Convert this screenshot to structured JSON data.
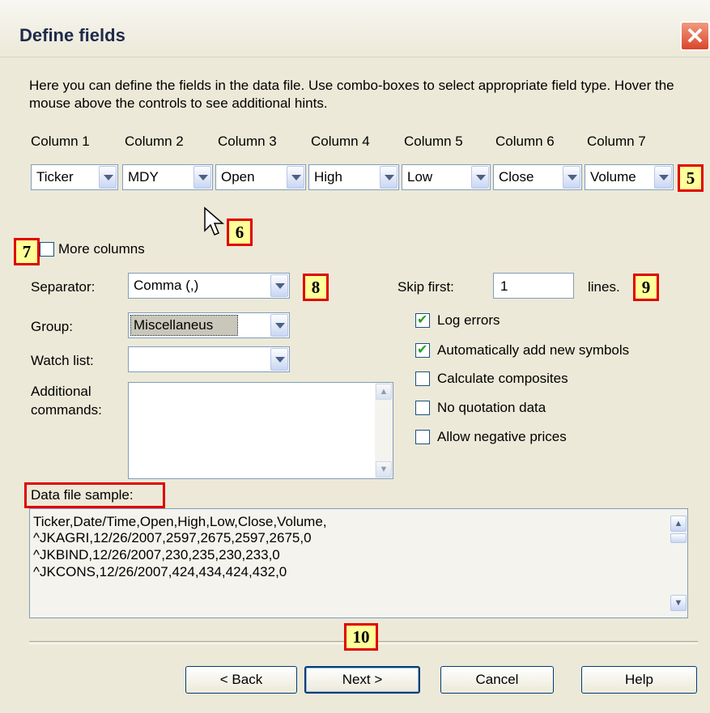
{
  "title": "Define fields",
  "intro": "Here you can define the fields in the data file. Use combo-boxes to select appropriate field type. Hover the mouse above the controls to see additional hints.",
  "columns": [
    {
      "header": "Column 1",
      "value": "Ticker"
    },
    {
      "header": "Column 2",
      "value": "MDY"
    },
    {
      "header": "Column 3",
      "value": "Open"
    },
    {
      "header": "Column 4",
      "value": "High"
    },
    {
      "header": "Column 5",
      "value": "Low"
    },
    {
      "header": "Column 6",
      "value": "Close"
    },
    {
      "header": "Column 7",
      "value": "Volume"
    }
  ],
  "callouts": {
    "c5": "5",
    "c6": "6",
    "c7": "7",
    "c8": "8",
    "c9": "9",
    "c10": "10"
  },
  "more_columns": "More columns",
  "separator": {
    "label": "Separator:",
    "value": "Comma (,)"
  },
  "group": {
    "label": "Group:",
    "value": "Miscellaneus"
  },
  "watch": {
    "label": "Watch list:",
    "value": ""
  },
  "additional": {
    "label1": "Additional",
    "label2": "commands:"
  },
  "skip": {
    "label": "Skip first:",
    "value": "1",
    "suffix": "lines."
  },
  "options": [
    {
      "label": "Log errors",
      "checked": true
    },
    {
      "label": "Automatically add new symbols",
      "checked": true
    },
    {
      "label": "Calculate composites",
      "checked": false
    },
    {
      "label": "No quotation data",
      "checked": false
    },
    {
      "label": "Allow negative prices",
      "checked": false
    }
  ],
  "sample": {
    "label": "Data file sample:",
    "lines": [
      "Ticker,Date/Time,Open,High,Low,Close,Volume,",
      "^JKAGRI,12/26/2007,2597,2675,2597,2675,0",
      "^JKBIND,12/26/2007,230,235,230,233,0",
      "^JKCONS,12/26/2007,424,434,424,432,0"
    ]
  },
  "buttons": {
    "back": "< Back",
    "next": "Next >",
    "cancel": "Cancel",
    "help": "Help"
  }
}
